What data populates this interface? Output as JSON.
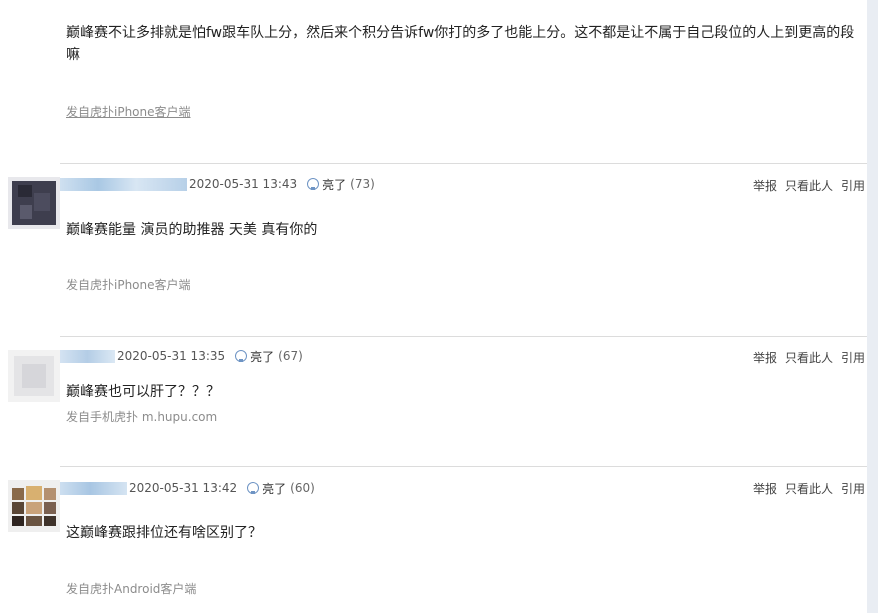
{
  "top_post": {
    "text": "巅峰赛不让多排就是怕fw跟车队上分，然后来个积分告诉fw你打的多了也能上分。这不都是让不属于自己段位的人上到更高的段嘛",
    "client": "发自虎扑iPhone客户端"
  },
  "replies": [
    {
      "time": "2020-05-31 13:43",
      "light_label": "亮了",
      "light_count": "(73)",
      "content": "巅峰赛能量 演员的助推器 天美 真有你的",
      "client": "发自虎扑iPhone客户端"
    },
    {
      "time": "2020-05-31 13:35",
      "light_label": "亮了",
      "light_count": "(67)",
      "content": "巅峰赛也可以肝了？？？",
      "client": "发自手机虎扑 m.hupu.com"
    },
    {
      "time": "2020-05-31 13:42",
      "light_label": "亮了",
      "light_count": "(60)",
      "content": "这巅峰赛跟排位还有啥区别了？",
      "client": "发自虎扑Android客户端"
    }
  ],
  "actions": {
    "report": "举报",
    "only_this": "只看此人",
    "quote": "引用"
  },
  "colors": {
    "divider": "#dcdcdc",
    "client_text": "#8c8c8c",
    "light_icon": "#6e94c4",
    "sidebar": "#e9edf3"
  },
  "icons": {
    "light": "lightbulb-icon"
  }
}
